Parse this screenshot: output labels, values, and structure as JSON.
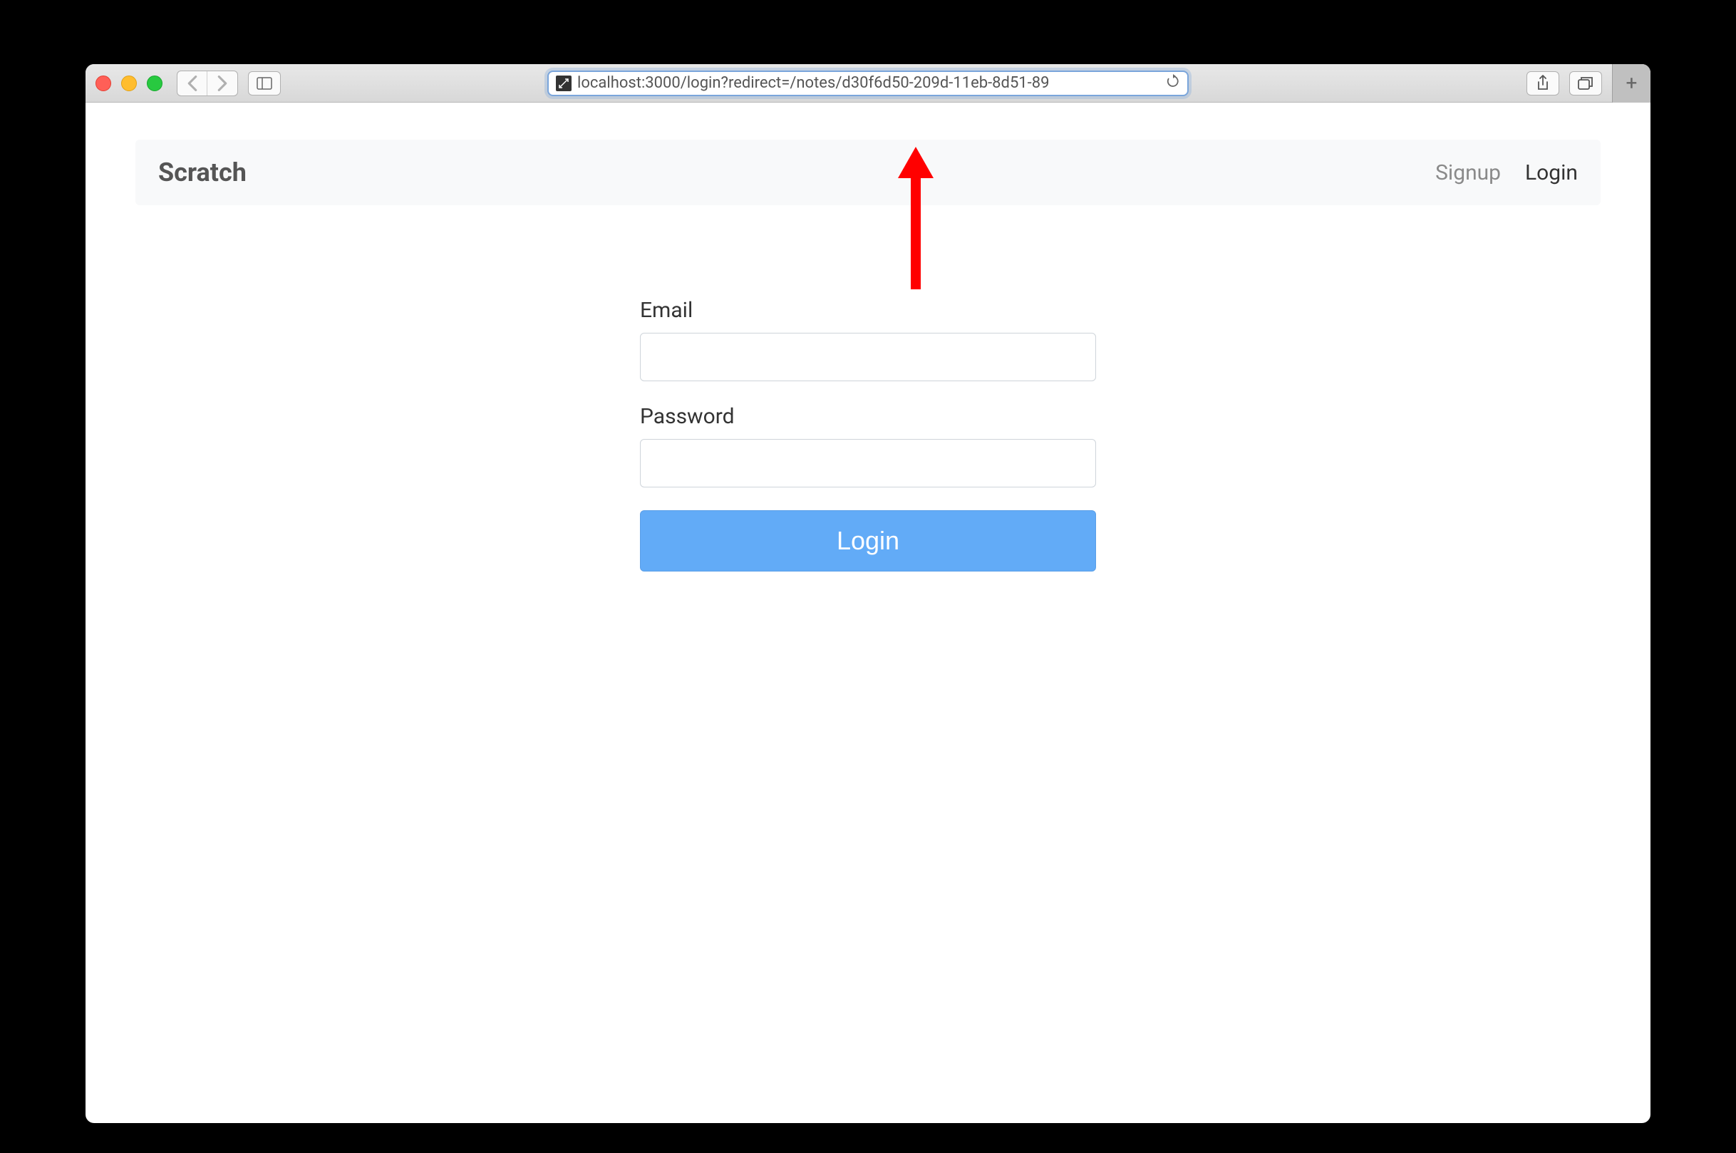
{
  "browser": {
    "url": "localhost:3000/login?redirect=/notes/d30f6d50-209d-11eb-8d51-89",
    "new_tab": "+"
  },
  "header": {
    "brand": "Scratch",
    "signup": "Signup",
    "login": "Login"
  },
  "form": {
    "email_label": "Email",
    "password_label": "Password",
    "login_button": "Login"
  }
}
